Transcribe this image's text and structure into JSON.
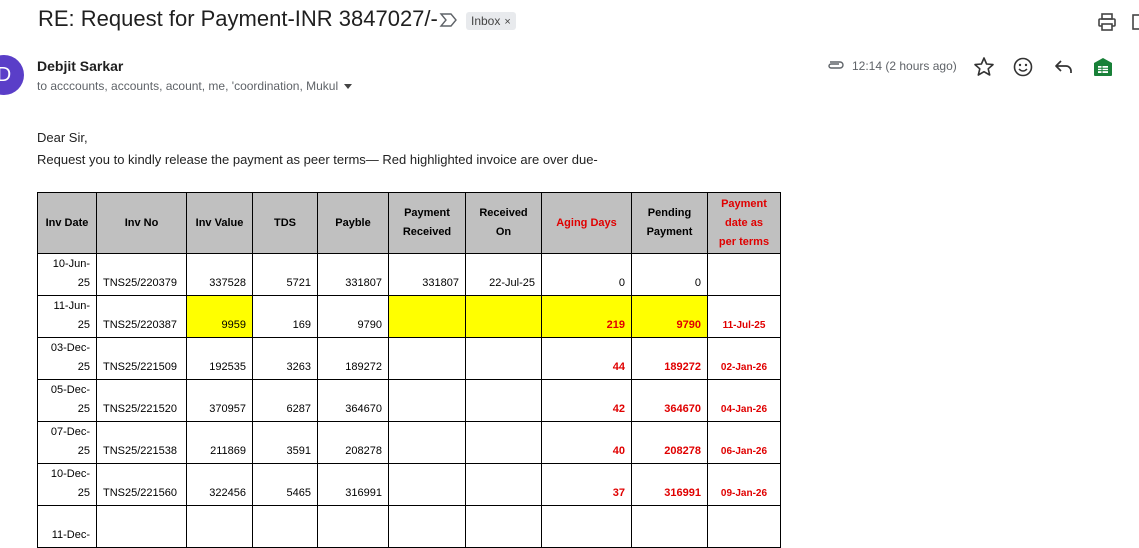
{
  "email": {
    "subject": "RE: Request for Payment-INR 3847027/-",
    "label": "Inbox",
    "label_close": "×",
    "sender": "Debjit Sarkar",
    "avatar_letter": "D",
    "recipients": "to acccounts, accounts, acount, me, 'coordination, Mukul",
    "time": "12:14 (2 hours ago)",
    "greeting": "Dear Sir,",
    "message": "Request you to kindly release the payment as peer terms— Red highlighted invoice are over due-"
  },
  "colors": {
    "overdue_red": "#e00000",
    "highlight_yellow": "#ffff00",
    "header_gray": "#c0c0c0",
    "avatar": "#5a3ec8"
  },
  "icons": [
    "label-importance-icon",
    "print-icon",
    "open-new-window-icon",
    "attachment-icon",
    "star-icon",
    "emoji-icon",
    "reply-icon",
    "sheets-icon"
  ],
  "table": {
    "headers": {
      "inv_date": "Inv Date",
      "inv_no": "Inv No",
      "inv_value": "Inv Value",
      "tds": "TDS",
      "payble": "Payble",
      "payment_received_1": "Payment",
      "payment_received_2": "Received",
      "received_on_1": "Received",
      "received_on_2": "On",
      "aging_days": "Aging Days",
      "pending_payment_1": "Pending",
      "pending_payment_2": "Payment",
      "payment_date_1": "Payment",
      "payment_date_2": "date  as",
      "payment_date_3": "per terms"
    },
    "rows": [
      {
        "date_a": "10-Jun-",
        "date_b": "25",
        "inv_no": "TNS25/220379",
        "inv_value": "337528",
        "tds": "5721",
        "payble": "331807",
        "payment_received": "331807",
        "received_on": "22-Jul-25",
        "aging_days": "0",
        "pending": "0",
        "due_date": ""
      },
      {
        "date_a": "11-Jun-",
        "date_b": "25",
        "inv_no": "TNS25/220387",
        "inv_value": "9959",
        "tds": "169",
        "payble": "9790",
        "payment_received": "",
        "received_on": "",
        "aging_days": "219",
        "pending": "9790",
        "due_date": "11-Jul-25"
      },
      {
        "date_a": "03-Dec-",
        "date_b": "25",
        "inv_no": "TNS25/221509",
        "inv_value": "192535",
        "tds": "3263",
        "payble": "189272",
        "payment_received": "",
        "received_on": "",
        "aging_days": "44",
        "pending": "189272",
        "due_date": "02-Jan-26"
      },
      {
        "date_a": "05-Dec-",
        "date_b": "25",
        "inv_no": "TNS25/221520",
        "inv_value": "370957",
        "tds": "6287",
        "payble": "364670",
        "payment_received": "",
        "received_on": "",
        "aging_days": "42",
        "pending": "364670",
        "due_date": "04-Jan-26"
      },
      {
        "date_a": "07-Dec-",
        "date_b": "25",
        "inv_no": "TNS25/221538",
        "inv_value": "211869",
        "tds": "3591",
        "payble": "208278",
        "payment_received": "",
        "received_on": "",
        "aging_days": "40",
        "pending": "208278",
        "due_date": "06-Jan-26"
      },
      {
        "date_a": "10-Dec-",
        "date_b": "25",
        "inv_no": "TNS25/221560",
        "inv_value": "322456",
        "tds": "5465",
        "payble": "316991",
        "payment_received": "",
        "received_on": "",
        "aging_days": "37",
        "pending": "316991",
        "due_date": "09-Jan-26"
      },
      {
        "date_a": "11-Dec-",
        "date_b": "",
        "inv_no": "",
        "inv_value": "",
        "tds": "",
        "payble": "",
        "payment_received": "",
        "received_on": "",
        "aging_days": "",
        "pending": "",
        "due_date": ""
      }
    ]
  }
}
